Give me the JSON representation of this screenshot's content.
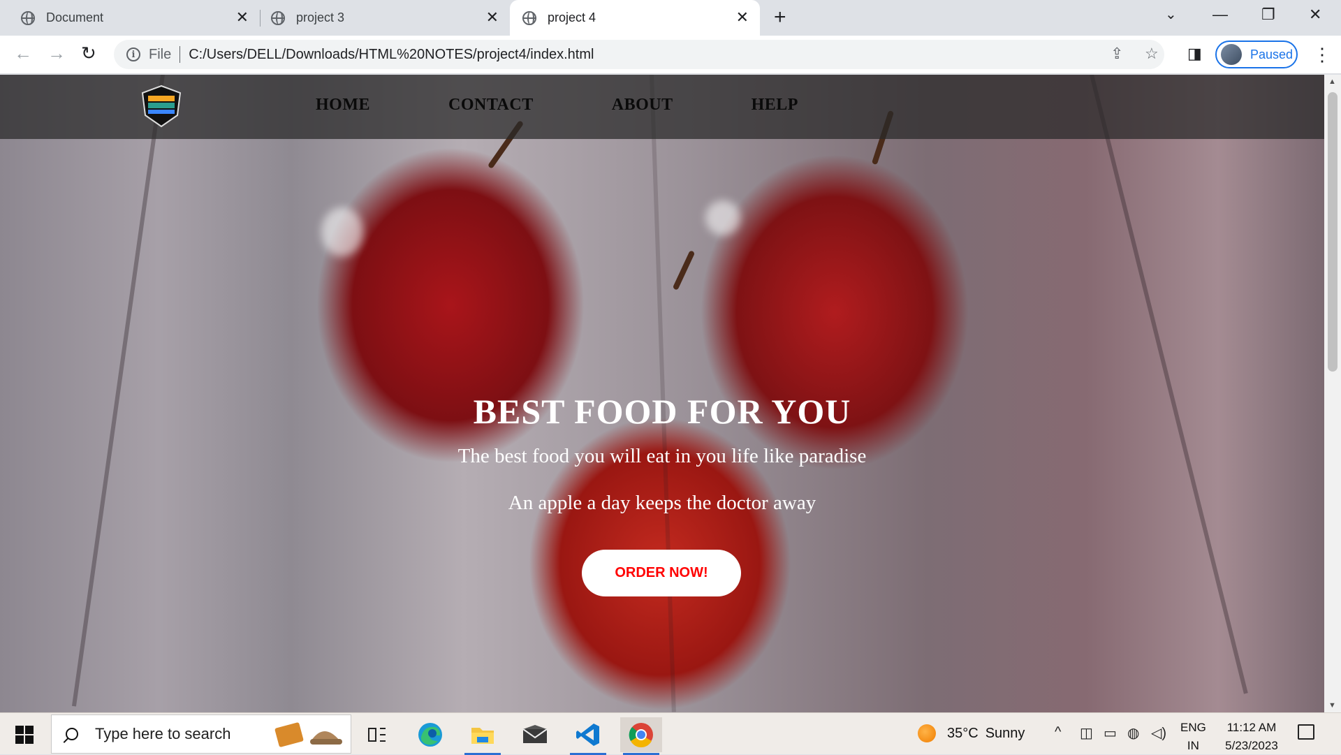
{
  "browser": {
    "tabs": [
      {
        "title": "Document",
        "close": "✕"
      },
      {
        "title": "project 3",
        "close": "✕"
      },
      {
        "title": "project 4",
        "close": "✕",
        "active": true
      }
    ],
    "new_tab": "+",
    "window_controls": {
      "tab_search": "⌄",
      "minimize": "—",
      "restore": "❐",
      "close": "✕"
    },
    "nav": {
      "back": "←",
      "forward": "→",
      "reload": "↻"
    },
    "address": {
      "scheme_label": "File",
      "url": "C:/Users/DELL/Downloads/HTML%20NOTES/project4/index.html"
    },
    "toolbar_icons": {
      "share": "⇪",
      "bookmark": "☆",
      "side_panel": "◨"
    },
    "profile_status": "Paused",
    "menu": "⋮"
  },
  "site": {
    "nav": [
      "HOME",
      "CONTACT",
      "ABOUT",
      "HELP"
    ],
    "hero": {
      "title": "BEST FOOD FOR YOU",
      "subtitle1": "The best food you will eat in you life like paradise",
      "subtitle2": "An apple a day keeps the doctor away",
      "cta": "ORDER NOW!"
    },
    "colors": {
      "cta_text": "#ff0000",
      "header_bg": "#282828",
      "hero_text": "#ffffff"
    }
  },
  "taskbar": {
    "search_placeholder": "Type here to search",
    "apps": [
      "task-view",
      "edge",
      "file-explorer",
      "mail",
      "vscode",
      "chrome"
    ],
    "weather": {
      "temp": "35°C",
      "condition": "Sunny"
    },
    "tray": {
      "chevron": "^",
      "language_line1": "ENG",
      "language_line2": "IN"
    },
    "time": "11:12 AM",
    "date": "5/23/2023"
  }
}
